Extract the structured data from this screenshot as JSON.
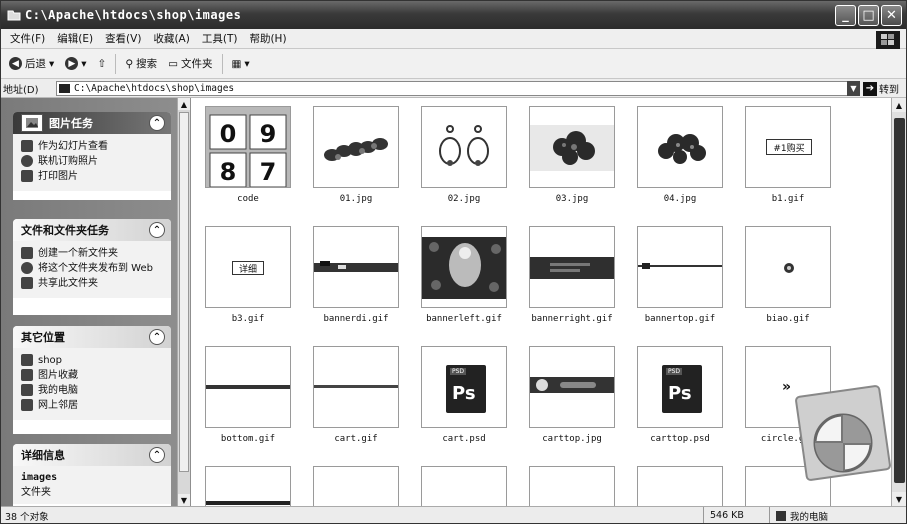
{
  "window": {
    "title": "C:\\Apache\\htdocs\\shop\\images"
  },
  "menu": [
    "文件(F)",
    "编辑(E)",
    "查看(V)",
    "收藏(A)",
    "工具(T)",
    "帮助(H)"
  ],
  "toolbar": {
    "back": "后退",
    "search": "搜索",
    "folders": "文件夹"
  },
  "address": {
    "label": "地址(D)",
    "value": "C:\\Apache\\htdocs\\shop\\images",
    "go": "转到"
  },
  "panels": {
    "picture_tasks": {
      "title": "图片任务",
      "items": [
        "作为幻灯片查看",
        "联机订购照片",
        "打印图片"
      ]
    },
    "file_tasks": {
      "title": "文件和文件夹任务",
      "items": [
        "创建一个新文件夹",
        "将这个文件夹发布到 Web",
        "共享此文件夹"
      ]
    },
    "other_places": {
      "title": "其它位置",
      "items": [
        "shop",
        "图片收藏",
        "我的电脑",
        "网上邻居"
      ]
    },
    "details": {
      "title": "详细信息",
      "name": "images",
      "type": "文件夹"
    }
  },
  "files": [
    {
      "name": "code",
      "kind": "folder"
    },
    {
      "name": "01.jpg",
      "kind": "jpg"
    },
    {
      "name": "02.jpg",
      "kind": "jpg"
    },
    {
      "name": "03.jpg",
      "kind": "jpg"
    },
    {
      "name": "04.jpg",
      "kind": "jpg"
    },
    {
      "name": "b1.gif",
      "kind": "gif",
      "label": "#1购买"
    },
    {
      "name": "b3.gif",
      "kind": "gif",
      "label": "详细"
    },
    {
      "name": "bannerdi.gif",
      "kind": "gif"
    },
    {
      "name": "bannerleft.gif",
      "kind": "gif"
    },
    {
      "name": "bannerright.gif",
      "kind": "gif"
    },
    {
      "name": "bannertop.gif",
      "kind": "gif"
    },
    {
      "name": "biao.gif",
      "kind": "gif"
    },
    {
      "name": "bottom.gif",
      "kind": "gif"
    },
    {
      "name": "cart.gif",
      "kind": "gif"
    },
    {
      "name": "cart.psd",
      "kind": "psd",
      "badge": "PSD",
      "label": "Ps"
    },
    {
      "name": "carttop.jpg",
      "kind": "jpg"
    },
    {
      "name": "carttop.psd",
      "kind": "psd",
      "badge": "PSD",
      "label": "Ps"
    },
    {
      "name": "circle.gif",
      "kind": "gif",
      "label": "»"
    }
  ],
  "folder_icon_digits": [
    "0",
    "9",
    "8",
    "7"
  ],
  "status": {
    "count": "38 个对象",
    "size": "546 KB",
    "location": "我的电脑"
  }
}
